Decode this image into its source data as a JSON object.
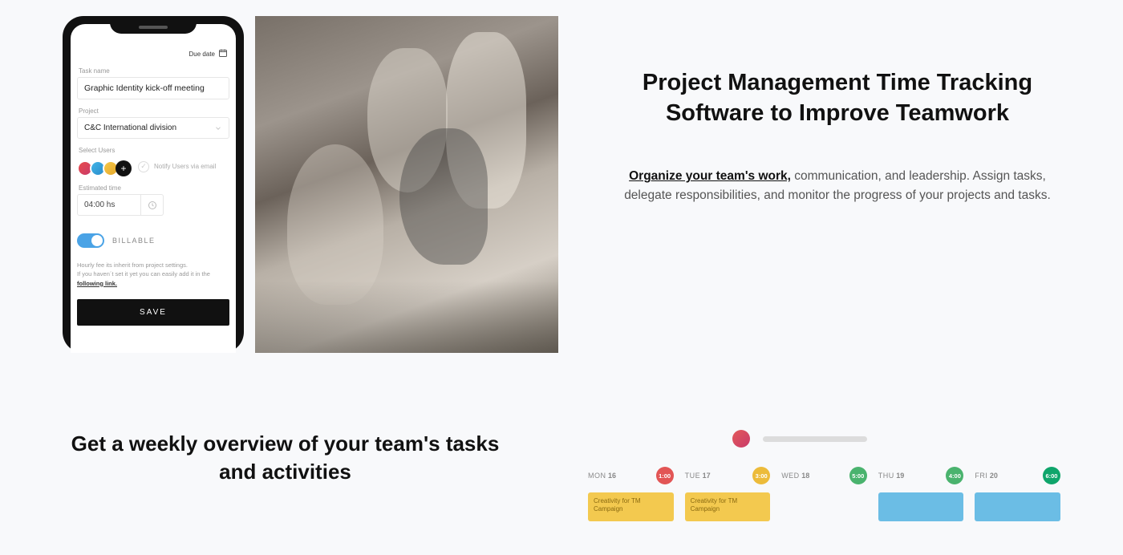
{
  "section1": {
    "heading": "Project Management Time Tracking Software to Improve Teamwork",
    "body_bold": "Organize your team's work,",
    "body_rest": " communication, and leadership. Assign tasks, delegate responsibilities, and monitor the progress of your projects and tasks."
  },
  "phone": {
    "due_label": "Due date",
    "task_label": "Task name",
    "task_value": "Graphic Identity kick-off meeting",
    "project_label": "Project",
    "project_value": "C&C International division",
    "users_label": "Select Users",
    "notify_label": "Notify Users via email",
    "est_label": "Estimated time",
    "est_value": "04:00 hs",
    "billable_label": "BILLABLE",
    "fine1": "Hourly fee its inherit from project settings.",
    "fine2a": "If you haven´t set it yet you can easily add it in the ",
    "fine2b": "following link.",
    "save_label": "SAVE"
  },
  "section2": {
    "heading": "Get a weekly overview of your team's tasks and activities"
  },
  "timeline": {
    "days": [
      {
        "name": "MON",
        "num": "16",
        "time": "1:00",
        "pill": "red",
        "card": "Creativity for TM Campaign",
        "card_style": "yellow"
      },
      {
        "name": "TUE",
        "num": "17",
        "time": "3:00",
        "pill": "orange",
        "card": "Creativity for TM Campaign",
        "card_style": "yellow"
      },
      {
        "name": "WED",
        "num": "18",
        "time": "5:00",
        "pill": "green",
        "card": "",
        "card_style": ""
      },
      {
        "name": "THU",
        "num": "19",
        "time": "4:00",
        "pill": "green",
        "card": "",
        "card_style": "blue"
      },
      {
        "name": "FRI",
        "num": "20",
        "time": "6:00",
        "pill": "dgreen",
        "card": "",
        "card_style": "blue"
      }
    ]
  }
}
